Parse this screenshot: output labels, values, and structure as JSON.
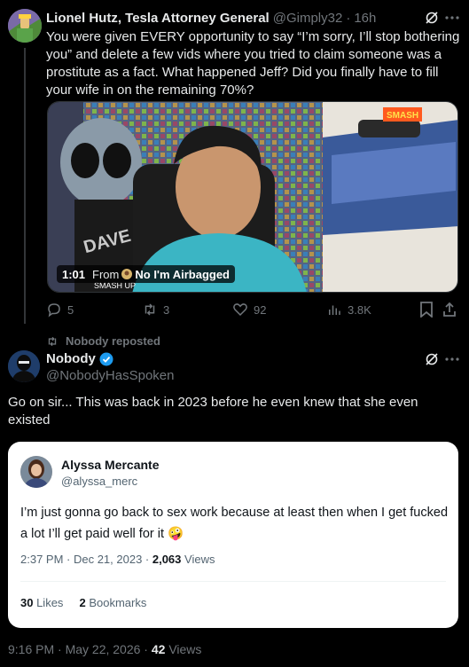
{
  "post1": {
    "name": "Lionel Hutz, Tesla Attorney General",
    "handle": "@Gimply32",
    "sep": "·",
    "time": "16h",
    "text": "You were given EVERY opportunity to say “I’m sorry, I’ll stop bothering you” and delete a few vids where you tried to claim someone was a prostitute as a fact. What happened Jeff? Did you finally have to fill your wife in on the remaining 70%?",
    "video": {
      "duration": "1:01",
      "from_label": "From",
      "source_name": "No I'm Airbagged",
      "sign_text": "SMASH",
      "shirt_text": "SMASH UP"
    },
    "actions": {
      "replies": "5",
      "reposts": "3",
      "likes": "92",
      "views": "3.8K"
    }
  },
  "repost_note": "Nobody reposted",
  "post2": {
    "name": "Nobody",
    "handle": "@NobodyHasSpoken",
    "text": "Go on sir... This was back in 2023 before he even knew that she even existed",
    "quoted": {
      "name": "Alyssa Mercante",
      "handle": "@alyssa_merc",
      "text": "I’m just gonna go back to sex work because at least then when I get fucked a lot I’ll get paid well for it 🤪",
      "time": "2:37 PM · Dec 21, 2023 · ",
      "views_count": "2,063",
      "views_label": " Views",
      "likes_count": "30",
      "likes_label": " Likes",
      "bookmarks_count": "2",
      "bookmarks_label": " Bookmarks"
    },
    "footer_time": "9:16 PM · May 22, 2026 · ",
    "footer_views_count": "42",
    "footer_views_label": " Views"
  },
  "colors": {
    "background": "#000000",
    "text_primary": "#e7e9ea",
    "text_secondary": "#71767b",
    "verified_blue": "#1d9bf0",
    "divider": "#2f3336"
  }
}
